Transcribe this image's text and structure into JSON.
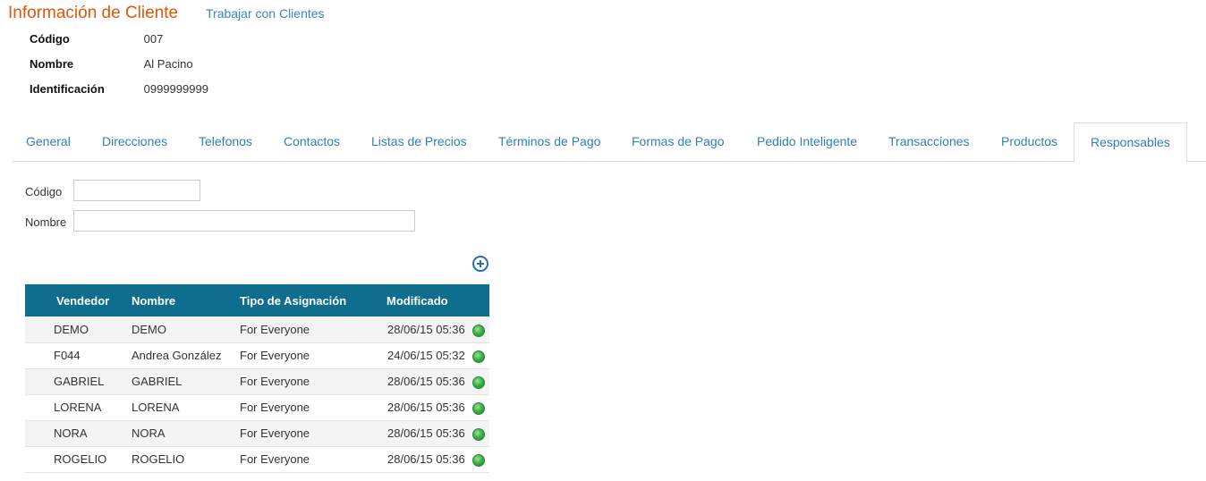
{
  "header": {
    "title": "Información de Cliente",
    "link": "Trabajar con Clientes"
  },
  "info": [
    {
      "label": "Código",
      "value": "007"
    },
    {
      "label": "Nombre",
      "value": "Al Pacino"
    },
    {
      "label": "Identificación",
      "value": "0999999999"
    }
  ],
  "tabs": [
    {
      "label": "General"
    },
    {
      "label": "Direcciones"
    },
    {
      "label": "Telefonos"
    },
    {
      "label": "Contactos"
    },
    {
      "label": "Listas de Precios"
    },
    {
      "label": "Términos de Pago"
    },
    {
      "label": "Formas de Pago"
    },
    {
      "label": "Pedido Inteligente"
    },
    {
      "label": "Transacciones"
    },
    {
      "label": "Productos"
    },
    {
      "label": "Responsables",
      "active": true
    }
  ],
  "filters": {
    "code_label": "Código",
    "code_value": "",
    "name_label": "Nombre",
    "name_value": ""
  },
  "add_icon": "plus-circle-icon",
  "table": {
    "columns": [
      "Vendedor",
      "Nombre",
      "Tipo de Asignación",
      "Modificado"
    ],
    "rows": [
      {
        "vendedor": "DEMO",
        "nombre": "DEMO",
        "tipo": "For Everyone",
        "modificado": "28/06/15 05:36",
        "status": "green"
      },
      {
        "vendedor": "F044",
        "nombre": "Andrea González",
        "tipo": "For Everyone",
        "modificado": "24/06/15 05:32",
        "status": "green"
      },
      {
        "vendedor": "GABRIEL",
        "nombre": "GABRIEL",
        "tipo": "For Everyone",
        "modificado": "28/06/15 05:36",
        "status": "green"
      },
      {
        "vendedor": "LORENA",
        "nombre": "LORENA",
        "tipo": "For Everyone",
        "modificado": "28/06/15 05:36",
        "status": "green"
      },
      {
        "vendedor": "NORA",
        "nombre": "NORA",
        "tipo": "For Everyone",
        "modificado": "28/06/15 05:36",
        "status": "green"
      },
      {
        "vendedor": "ROGELIO",
        "nombre": "ROGELIO",
        "tipo": "For Everyone",
        "modificado": "28/06/15 05:36",
        "status": "green"
      }
    ]
  },
  "colors": {
    "title": "#e0560c",
    "link": "#2f80b9",
    "table_header": "#0f6d8d",
    "status_green": "#3fb34a"
  }
}
